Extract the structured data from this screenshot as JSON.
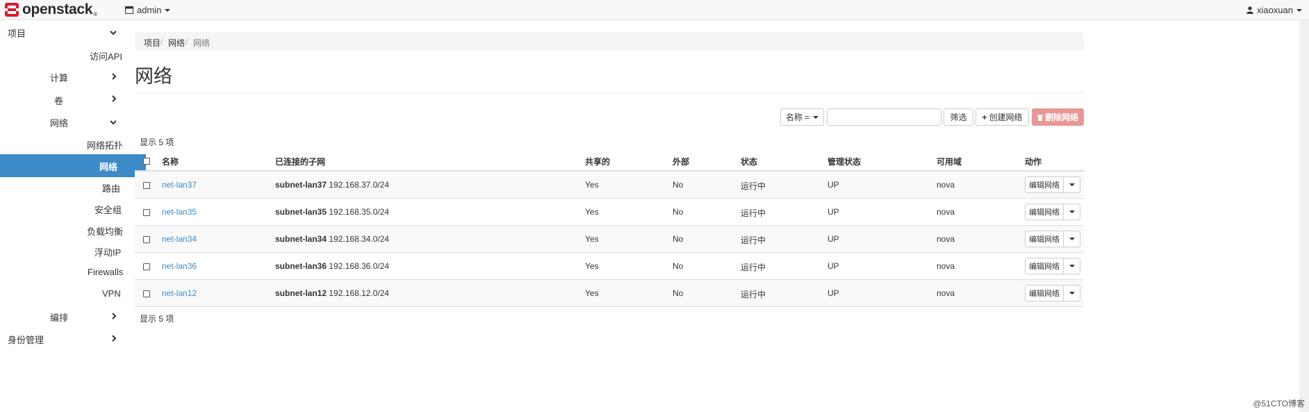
{
  "brand": {
    "name": "openstack",
    "reg": "®"
  },
  "topbar": {
    "project": "admin",
    "user": "xiaoxuan"
  },
  "sidebar": {
    "items": [
      {
        "label": "项目"
      },
      {
        "label": "访问API"
      },
      {
        "label": "计算"
      },
      {
        "label": "卷"
      },
      {
        "label": "网络"
      },
      {
        "label": "网络拓扑"
      },
      {
        "label": "网络"
      },
      {
        "label": "路由"
      },
      {
        "label": "安全组"
      },
      {
        "label": "负载均衡"
      },
      {
        "label": "浮动IP"
      },
      {
        "label": "Firewalls"
      },
      {
        "label": "VPN"
      },
      {
        "label": "编排"
      },
      {
        "label": "身份管理"
      }
    ]
  },
  "breadcrumb": [
    "项目",
    "网络",
    "网络"
  ],
  "breadcrumb_sep": "/",
  "page_title": "网络",
  "toolbar": {
    "filter_field": "名称 =",
    "filter_button": "筛选",
    "create_button": "创建网络",
    "delete_button": "删除网络"
  },
  "count_text": "显示 5 项",
  "table": {
    "headers": [
      "名称",
      "已连接的子网",
      "共享的",
      "外部",
      "状态",
      "管理状态",
      "可用域",
      "动作"
    ],
    "rows": [
      {
        "name": "net-lan37",
        "subnet_name": "subnet-lan37",
        "cidr": "192.168.37.0/24",
        "shared": "Yes",
        "external": "No",
        "status": "运行中",
        "admin_state": "UP",
        "zone": "nova",
        "action": "编辑网络"
      },
      {
        "name": "net-lan35",
        "subnet_name": "subnet-lan35",
        "cidr": "192.168.35.0/24",
        "shared": "Yes",
        "external": "No",
        "status": "运行中",
        "admin_state": "UP",
        "zone": "nova",
        "action": "编辑网络"
      },
      {
        "name": "net-lan34",
        "subnet_name": "subnet-lan34",
        "cidr": "192.168.34.0/24",
        "shared": "Yes",
        "external": "No",
        "status": "运行中",
        "admin_state": "UP",
        "zone": "nova",
        "action": "编辑网络"
      },
      {
        "name": "net-lan36",
        "subnet_name": "subnet-lan36",
        "cidr": "192.168.36.0/24",
        "shared": "Yes",
        "external": "No",
        "status": "运行中",
        "admin_state": "UP",
        "zone": "nova",
        "action": "编辑网络"
      },
      {
        "name": "net-lan12",
        "subnet_name": "subnet-lan12",
        "cidr": "192.168.12.0/24",
        "shared": "Yes",
        "external": "No",
        "status": "运行中",
        "admin_state": "UP",
        "zone": "nova",
        "action": "编辑网络"
      }
    ]
  },
  "watermark": "@51CTO博客",
  "colors": {
    "accent": "#3c8ac8",
    "danger": "#e99794",
    "logo_red": "#da1a32"
  }
}
